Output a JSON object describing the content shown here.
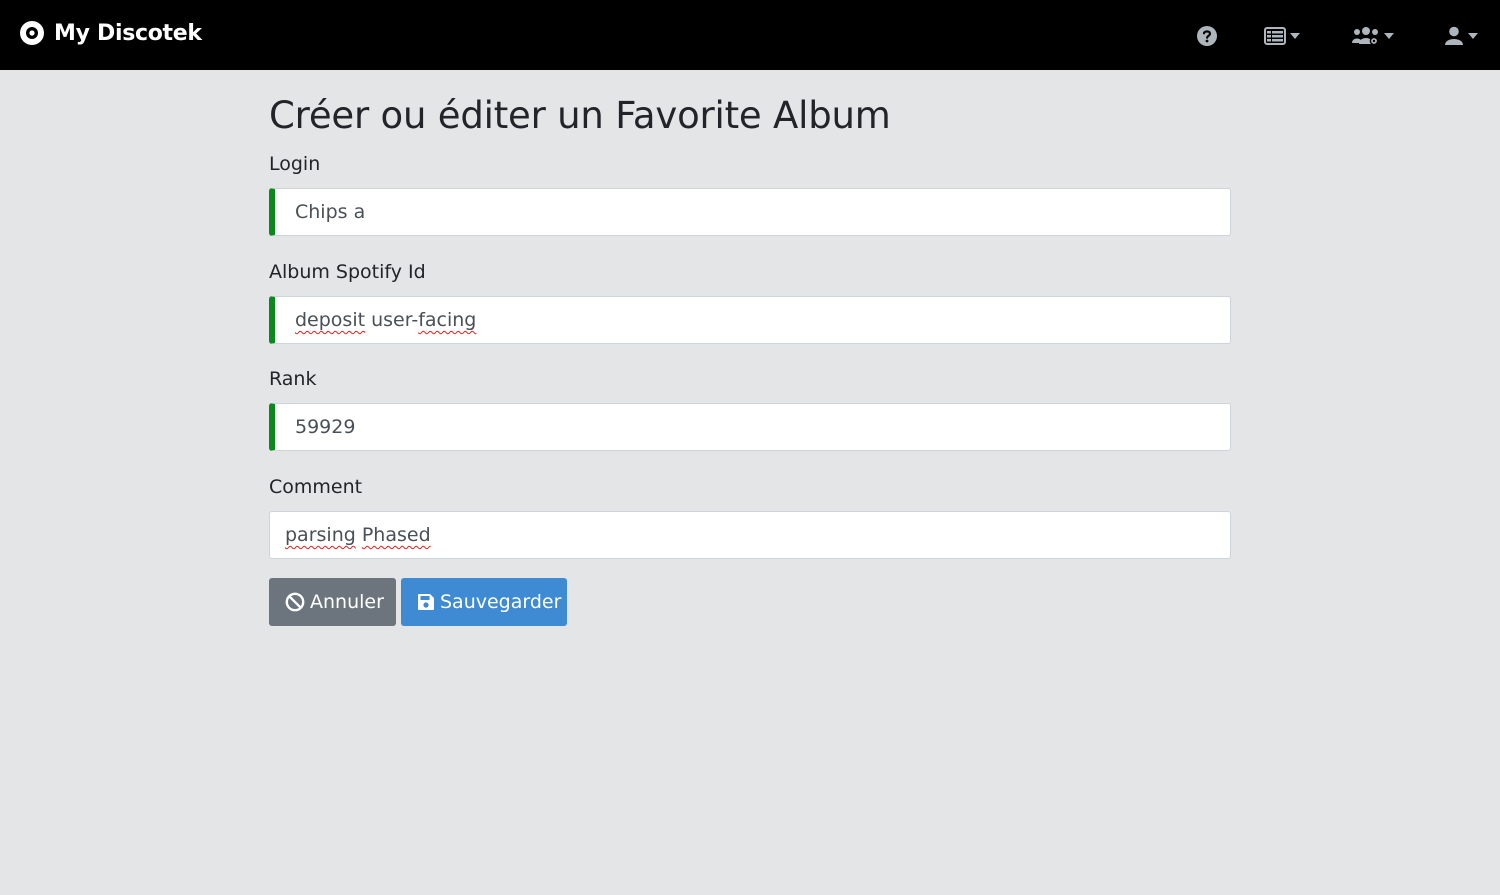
{
  "app": {
    "brand": "My Discotek"
  },
  "navbar": {
    "items": [
      {
        "icon": "help-icon",
        "has_dropdown": false
      },
      {
        "icon": "entities-list-icon",
        "has_dropdown": true
      },
      {
        "icon": "users-admin-icon",
        "has_dropdown": true
      },
      {
        "icon": "account-icon",
        "has_dropdown": true
      }
    ]
  },
  "page": {
    "title": "Créer ou éditer un Favorite Album"
  },
  "form": {
    "fields": [
      {
        "label": "Login",
        "value": "Chips a",
        "valid": true
      },
      {
        "label": "Album Spotify Id",
        "value_words": [
          "deposit",
          " user-",
          "facing"
        ],
        "valid": true
      },
      {
        "label": "Rank",
        "value": "59929",
        "valid": true
      },
      {
        "label": "Comment",
        "value_words": [
          "parsing",
          " ",
          "Phased"
        ],
        "valid": false
      }
    ],
    "cancel_label": "Annuler",
    "save_label": "Sauvegarder"
  },
  "colors": {
    "navbar_bg": "#000000",
    "page_bg": "#e4e5e7",
    "valid_border": "#0a8a1e",
    "cancel_button": "#6c757d",
    "save_button": "#3e8ad3"
  }
}
